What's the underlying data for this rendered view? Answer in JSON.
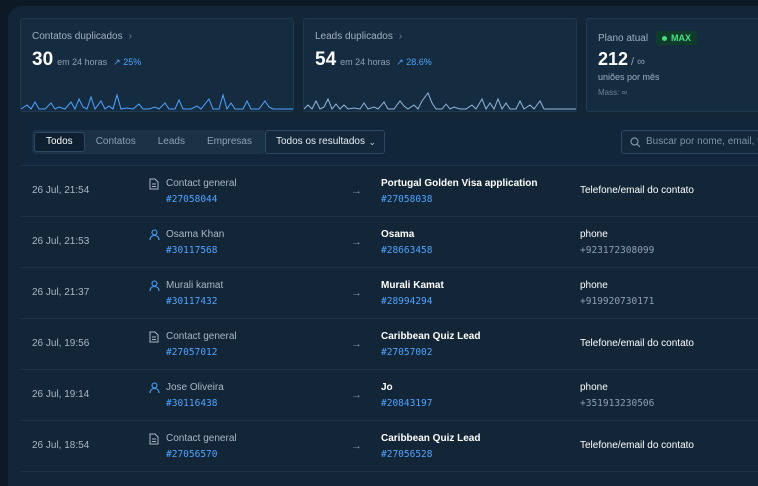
{
  "stats": {
    "contatos": {
      "title": "Contatos duplicados",
      "value": "30",
      "period": "em 24 horas",
      "change": "↗ 25%"
    },
    "leads": {
      "title": "Leads duplicados",
      "value": "54",
      "period": "em 24 horas",
      "change": "↗ 28.6%"
    },
    "plano": {
      "title": "Plano atual",
      "badge": "MAX",
      "value": "212",
      "limit": "/ ∞",
      "unit": "uniões por mês",
      "mass": "Mass: ∞"
    }
  },
  "filters": {
    "tabs": [
      "Todos",
      "Contatos",
      "Leads",
      "Empresas"
    ],
    "active_tab": "Todos",
    "select_value": "Todos os resultados",
    "search_placeholder": "Buscar por nome, email, telefone"
  },
  "colors": {
    "accent": "#4ea3ff",
    "badge_green": "#4ade80",
    "background": "#132638"
  },
  "rows": [
    {
      "date": "26 Jul, 21:54",
      "src_type": "document-icon",
      "src_name": "Contact general",
      "src_id": "#27058044",
      "dst_name": "Portugal Golden Visa application",
      "dst_id": "#27058038",
      "match": "Telefone/email do contato",
      "match_value": ""
    },
    {
      "date": "26 Jul, 21:53",
      "src_type": "user-icon",
      "src_name": "Osama Khan",
      "src_id": "#30117568",
      "dst_name": "Osama",
      "dst_id": "#28663458",
      "match": "phone",
      "match_value": "+923172308099"
    },
    {
      "date": "26 Jul, 21:37",
      "src_type": "user-icon",
      "src_name": "Murali kamat",
      "src_id": "#30117432",
      "dst_name": "Murali Kamat",
      "dst_id": "#28994294",
      "match": "phone",
      "match_value": "+919920730171"
    },
    {
      "date": "26 Jul, 19:56",
      "src_type": "document-icon",
      "src_name": "Contact general",
      "src_id": "#27057012",
      "dst_name": "Caribbean Quiz Lead",
      "dst_id": "#27057002",
      "match": "Telefone/email do contato",
      "match_value": ""
    },
    {
      "date": "26 Jul, 19:14",
      "src_type": "user-icon",
      "src_name": "Jose Oliveira",
      "src_id": "#30116438",
      "dst_name": "Jo",
      "dst_id": "#20843197",
      "match": "phone",
      "match_value": "+351913230506"
    },
    {
      "date": "26 Jul, 18:54",
      "src_type": "document-icon",
      "src_name": "Contact general",
      "src_id": "#27056570",
      "dst_name": "Caribbean Quiz Lead",
      "dst_id": "#27056528",
      "match": "Telefone/email do contato",
      "match_value": ""
    }
  ]
}
